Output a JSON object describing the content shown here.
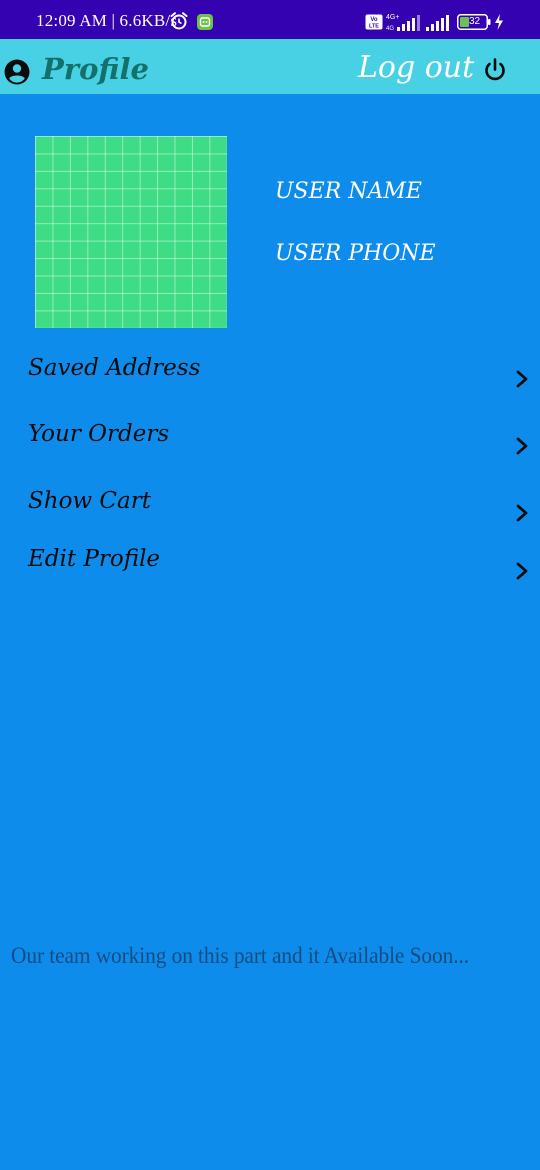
{
  "status_bar": {
    "time": "12:09 AM",
    "network_speed": "6.6KB/s",
    "battery_level": "32",
    "icons": [
      "alarm-icon",
      "app-notification-icon",
      "volte-icon",
      "signal-4g-icon",
      "signal-icon",
      "battery-icon",
      "charging-icon"
    ]
  },
  "app_bar": {
    "title": "Profile",
    "logout_label": "Log out",
    "icons": [
      "account-circle-icon",
      "power-icon"
    ],
    "background": "#48D1E4",
    "title_color": "#14706A"
  },
  "profile": {
    "user_name": "USER NAME",
    "user_phone": "USER PHONE",
    "image_color": "#3EDC84"
  },
  "menu": {
    "items": [
      {
        "label": "Saved Address"
      },
      {
        "label": "Your Orders"
      },
      {
        "label": "Show Cart"
      },
      {
        "label": "Edit Profile"
      }
    ]
  },
  "notice": {
    "text": "Our team working on this part and it Available Soon..."
  },
  "colors": {
    "page_background": "#0E8CEC",
    "status_bar": "#3402B0",
    "notice_text": "#174C80"
  }
}
